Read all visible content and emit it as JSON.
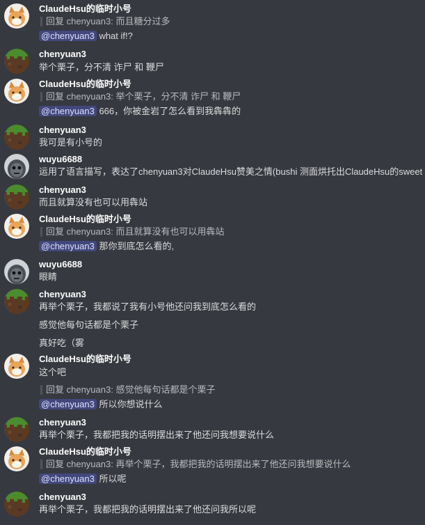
{
  "users": {
    "claude": "ClaudeHsu的临时小号",
    "chenyuan": "chenyuan3",
    "wuyu": "wuyu6688"
  },
  "mention_tag": "@chenyuan3",
  "messages": [
    {
      "user": "ClaudeHsu的临时小号",
      "reply": "回复 chenyuan3: 而且糖分过多",
      "text": "what if!?"
    },
    {
      "user": "chenyuan3",
      "text": "举个栗子，分不清 诈尸 和 鞭尸"
    },
    {
      "user": "ClaudeHsu的临时小号",
      "reply": "回复 chenyuan3: 举个栗子，分不清 诈尸 和 鞭尸",
      "text": "666，你被金岩了怎么看到我犇犇的"
    },
    {
      "user": "chenyuan3",
      "text": "我可是有小号的"
    },
    {
      "user": "wuyu6688",
      "text": "运用了语言描写，表达了chenyuan3对ClaudeHsu赞美之情(bushi 测面烘托出ClaudeHsu的sweet"
    },
    {
      "user": "chenyuan3",
      "text": "而且就算没有也可以用犇站"
    },
    {
      "user": "ClaudeHsu的临时小号",
      "reply": "回复 chenyuan3: 而且就算没有也可以用犇站",
      "text": "那你到底怎么看的,"
    },
    {
      "user": "wuyu6688",
      "text": "眼睛"
    },
    {
      "user": "chenyuan3",
      "lines": [
        "再举个栗子，我都说了我有小号他还问我到底怎么看的",
        "感觉他每句话都是个栗子",
        "真好吃（雾"
      ]
    },
    {
      "user": "ClaudeHsu的临时小号",
      "text": "这个吧",
      "reply": "回复 chenyuan3: 感觉他每句话都是个栗子",
      "text2": "所以你想说什么"
    },
    {
      "user": "chenyuan3",
      "text": "再举个栗子，我都把我的话明摆出来了他还问我想要说什么"
    },
    {
      "user": "ClaudeHsu的临时小号",
      "reply": "回复 chenyuan3: 再举个栗子，我都把我的话明摆出来了他还问我想要说什么",
      "text": "所以呢"
    },
    {
      "user": "chenyuan3",
      "text": "再举个栗子，我都把我的话明摆出来了他还问我所以呢"
    }
  ],
  "colors": {
    "background": "#36393f",
    "username": "#ffffff",
    "text": "#dcddde",
    "mention_bg": "#4b5290"
  }
}
